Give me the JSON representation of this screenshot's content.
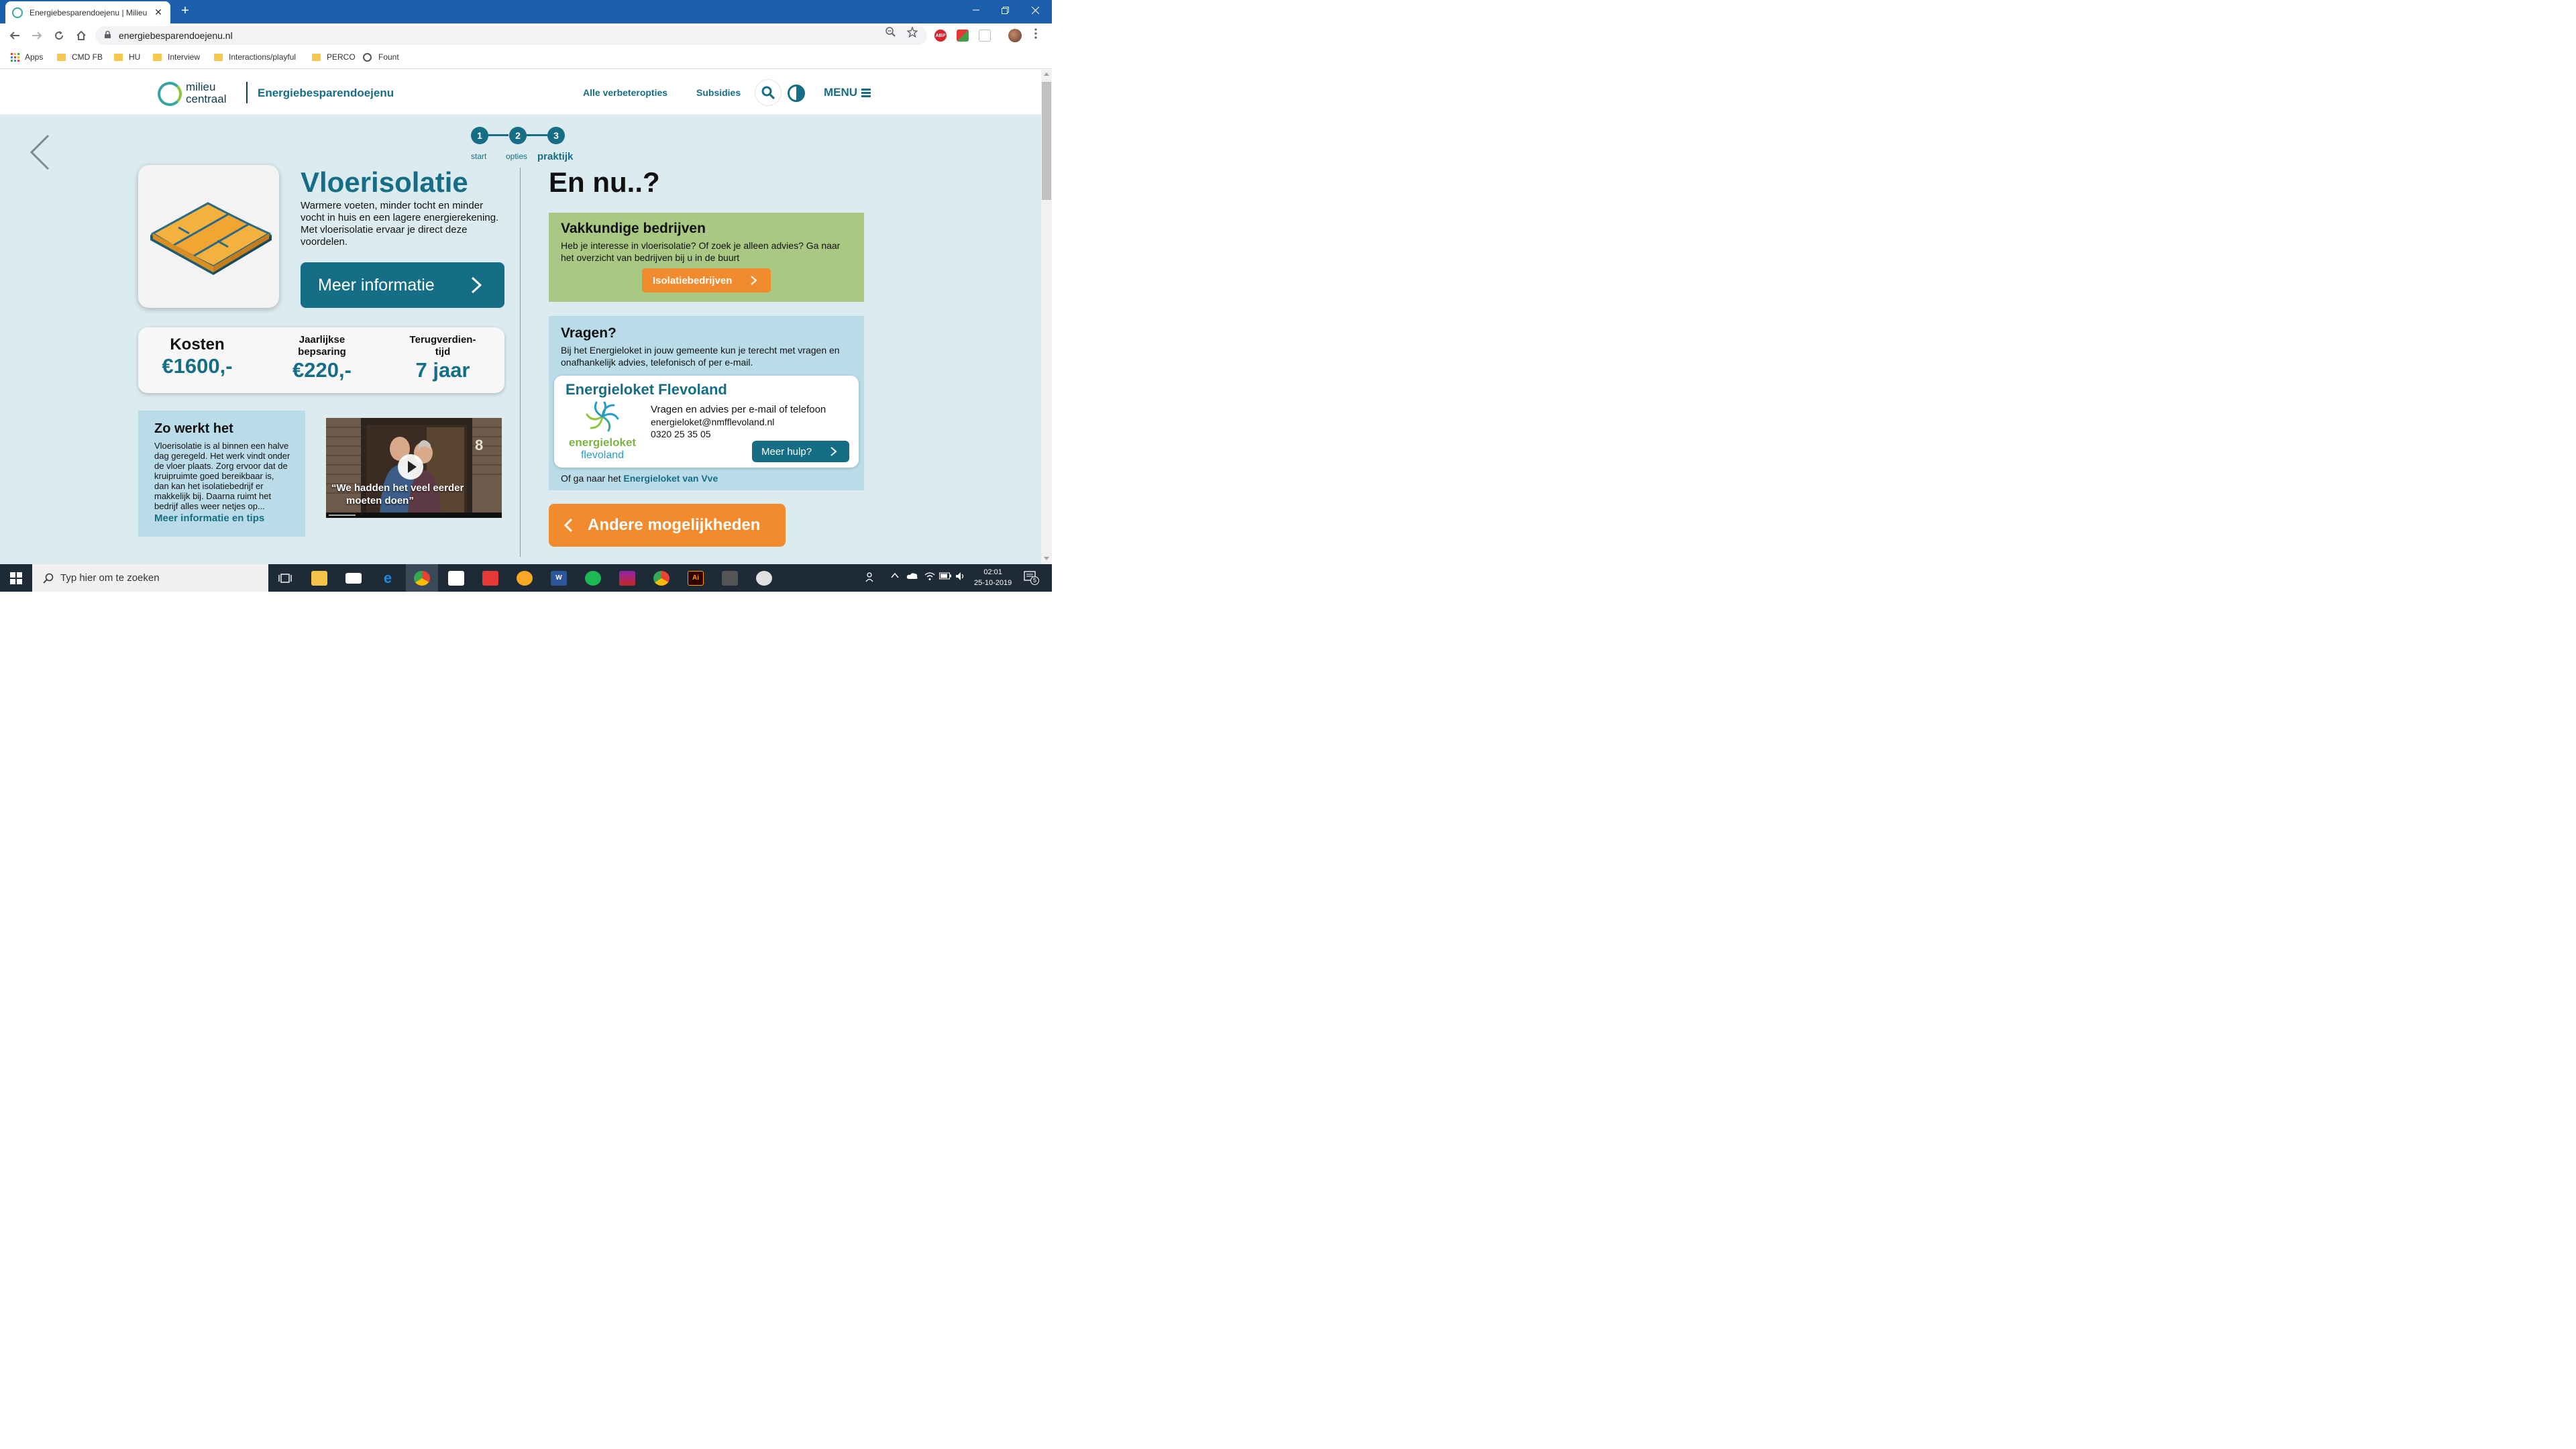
{
  "browser": {
    "tab_title": "Energiebesparendoejenu | Milieu",
    "tab_close": "✕",
    "new_tab": "+",
    "url": "energiebesparendoejenu.nl",
    "bookmarks": [
      {
        "label": "Apps",
        "type": "apps"
      },
      {
        "label": "CMD FB",
        "type": "folder"
      },
      {
        "label": "HU",
        "type": "folder"
      },
      {
        "label": "Interview",
        "type": "folder"
      },
      {
        "label": "Interactions/playful",
        "type": "folder"
      },
      {
        "label": "PERCO",
        "type": "folder"
      },
      {
        "label": "Fount",
        "type": "site"
      }
    ],
    "extensions": [
      "ABP"
    ]
  },
  "header": {
    "logo_line1": "milieu",
    "logo_line2": "centraal",
    "site_name": "Energiebesparendoejenu",
    "nav_link1": "Alle verbeteropties",
    "nav_link2": "Subsidies",
    "menu_label": "MENU"
  },
  "steps": [
    {
      "number": "1",
      "label": "start"
    },
    {
      "number": "2",
      "label": "opties"
    },
    {
      "number": "3",
      "label": "praktijk"
    }
  ],
  "product": {
    "title": "Vloerisolatie",
    "intro": "Warmere voeten, minder tocht en minder vocht in huis en een lagere energierekening. Met vloerisolatie ervaar je direct deze voordelen.",
    "more_info_button": "Meer informatie"
  },
  "stats": {
    "cost_label": "Kosten",
    "cost_value": "€1600,-",
    "saving_label_1": "Jaarlijkse",
    "saving_label_2": "bepsaring",
    "saving_value": "€220,-",
    "payback_label_1": "Terugverdien-",
    "payback_label_2": "tijd",
    "payback_value": "7 jaar"
  },
  "how_it_works": {
    "title": "Zo werkt het",
    "text": "Vloerisolatie is al binnen een halve dag geregeld. Het werk vindt onder de vloer plaats. Zorg ervoor dat de kruipruimte goed bereikbaar is, dan kan het isolatiebedrijf er makkelijk bij. Daarna ruimt het bedrijf alles weer netjes op...",
    "link": "Meer informatie en tips"
  },
  "video": {
    "quote_line1": "“We hadden het veel eerder",
    "quote_line2": "moeten doen”",
    "house_number": "8"
  },
  "next": {
    "title": "En nu..?",
    "companies": {
      "title": "Vakkundige bedrijven",
      "text": "Heb je interesse in vloerisolatie? Of zoek je alleen advies? Ga naar het overzicht van bedrijven bij u in de buurt",
      "button": "Isolatiebedrijven"
    },
    "questions": {
      "title": "Vragen?",
      "text": "Bij het Energieloket in jouw gemeente kun je terecht met vragen en onafhankelijk advies, telefonisch of per e-mail.",
      "loket_title": "Energieloket Flevoland",
      "logo_word1": "energieloket",
      "logo_word2": "flevoland",
      "info_line1": "Vragen en advies per e-mail of telefoon",
      "email": "energieloket@nmfflevoland.nl",
      "phone": "0320 25 35 05",
      "help_button": "Meer hulp?",
      "alt_prefix": "Of ga naar het",
      "alt_link": "Energieloket van Vve"
    },
    "other_button": "Andere mogelijkheden"
  },
  "taskbar": {
    "search_placeholder": "Typ hier om te zoeken",
    "time": "02:01",
    "date": "25-10-2019",
    "notifications": "5"
  },
  "colors": {
    "brand_teal": "#156e86",
    "orange": "#f28a2e",
    "green_box": "#a9c883",
    "blue_box": "#b9dce8",
    "page_bg": "#dcebef"
  }
}
